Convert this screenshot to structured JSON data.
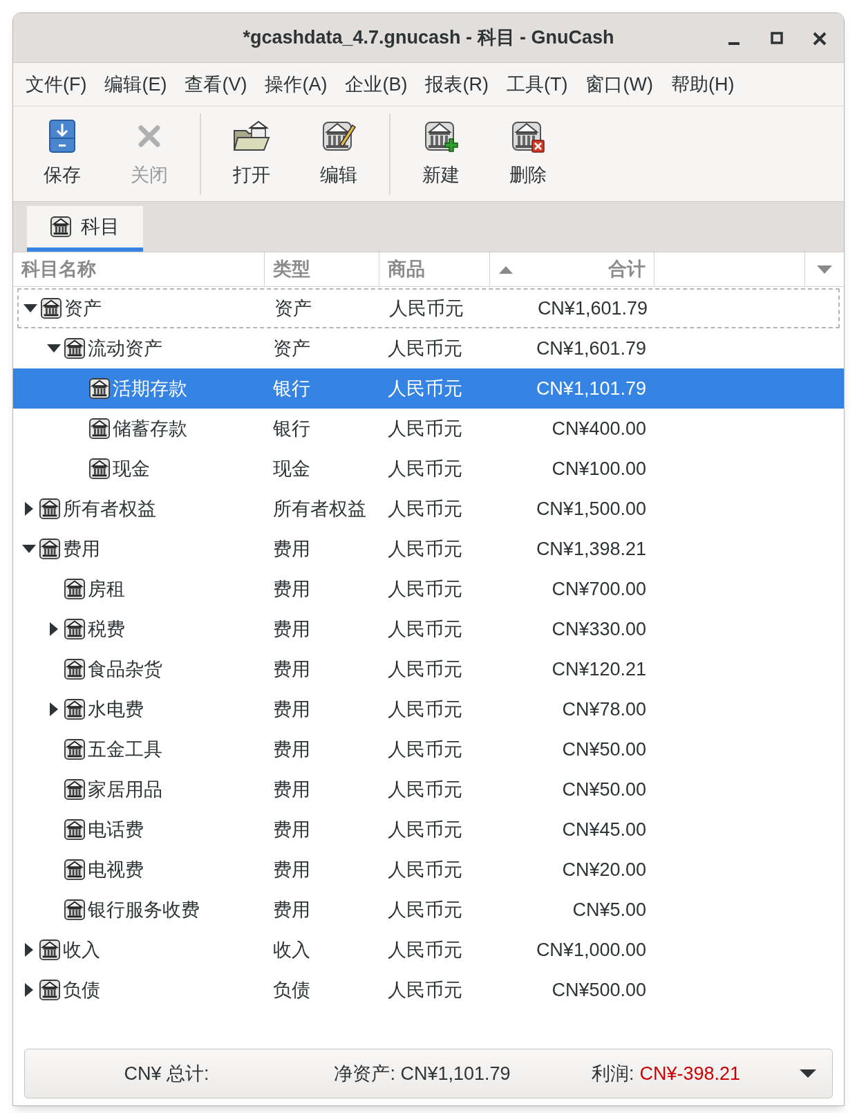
{
  "window": {
    "title": "*gcashdata_4.7.gnucash - 科目 - GnuCash"
  },
  "menu": [
    "文件(F)",
    "编辑(E)",
    "查看(V)",
    "操作(A)",
    "企业(B)",
    "报表(R)",
    "工具(T)",
    "窗口(W)",
    "帮助(H)"
  ],
  "toolbar": [
    [
      {
        "label": "保存",
        "kind": "save",
        "disabled": false
      },
      {
        "label": "关闭",
        "kind": "close",
        "disabled": true
      }
    ],
    [
      {
        "label": "打开",
        "kind": "open",
        "disabled": false
      },
      {
        "label": "编辑",
        "kind": "edit",
        "disabled": false
      }
    ],
    [
      {
        "label": "新建",
        "kind": "new",
        "disabled": false
      },
      {
        "label": "删除",
        "kind": "delete",
        "disabled": false
      }
    ]
  ],
  "tabs": [
    {
      "label": "科目",
      "selected": true
    }
  ],
  "columns": [
    {
      "label": "科目名称"
    },
    {
      "label": "类型"
    },
    {
      "label": "商品"
    },
    {
      "label": "合计",
      "sorted": true
    }
  ],
  "rows": [
    {
      "name": "资产",
      "type": "资产",
      "commodity": "人民币元",
      "total": "CN¥1,601.79",
      "expanded": true,
      "selected": false,
      "focused": true,
      "children": [
        {
          "name": "流动资产",
          "type": "资产",
          "commodity": "人民币元",
          "total": "CN¥1,601.79",
          "expanded": true,
          "selected": false,
          "children": [
            {
              "name": "活期存款",
              "type": "银行",
              "commodity": "人民币元",
              "total": "CN¥1,101.79",
              "selected": true
            },
            {
              "name": "储蓄存款",
              "type": "银行",
              "commodity": "人民币元",
              "total": "CN¥400.00",
              "selected": false
            },
            {
              "name": "现金",
              "type": "现金",
              "commodity": "人民币元",
              "total": "CN¥100.00",
              "selected": false
            }
          ]
        }
      ]
    },
    {
      "name": "所有者权益",
      "type": "所有者权益",
      "commodity": "人民币元",
      "total": "CN¥1,500.00",
      "expanded": false,
      "selected": false
    },
    {
      "name": "费用",
      "type": "费用",
      "commodity": "人民币元",
      "total": "CN¥1,398.21",
      "expanded": true,
      "selected": false,
      "children": [
        {
          "name": "房租",
          "type": "费用",
          "commodity": "人民币元",
          "total": "CN¥700.00",
          "selected": false
        },
        {
          "name": "税费",
          "type": "费用",
          "commodity": "人民币元",
          "total": "CN¥330.00",
          "expanded": false,
          "selected": false
        },
        {
          "name": "食品杂货",
          "type": "费用",
          "commodity": "人民币元",
          "total": "CN¥120.21",
          "selected": false
        },
        {
          "name": "水电费",
          "type": "费用",
          "commodity": "人民币元",
          "total": "CN¥78.00",
          "expanded": false,
          "selected": false
        },
        {
          "name": "五金工具",
          "type": "费用",
          "commodity": "人民币元",
          "total": "CN¥50.00",
          "selected": false
        },
        {
          "name": "家居用品",
          "type": "费用",
          "commodity": "人民币元",
          "total": "CN¥50.00",
          "selected": false
        },
        {
          "name": "电话费",
          "type": "费用",
          "commodity": "人民币元",
          "total": "CN¥45.00",
          "selected": false
        },
        {
          "name": "电视费",
          "type": "费用",
          "commodity": "人民币元",
          "total": "CN¥20.00",
          "selected": false
        },
        {
          "name": "银行服务收费",
          "type": "费用",
          "commodity": "人民币元",
          "total": "CN¥5.00",
          "selected": false
        }
      ]
    },
    {
      "name": "收入",
      "type": "收入",
      "commodity": "人民币元",
      "total": "CN¥1,000.00",
      "expanded": false,
      "selected": false
    },
    {
      "name": "负债",
      "type": "负债",
      "commodity": "人民币元",
      "total": "CN¥500.00",
      "expanded": false,
      "selected": false
    }
  ],
  "summary": {
    "label": "CN¥ 总计:",
    "net_assets": "净资产: CN¥1,101.79",
    "profit_label": "利润:",
    "profit": "CN¥-398.21",
    "profit_negative": true
  }
}
